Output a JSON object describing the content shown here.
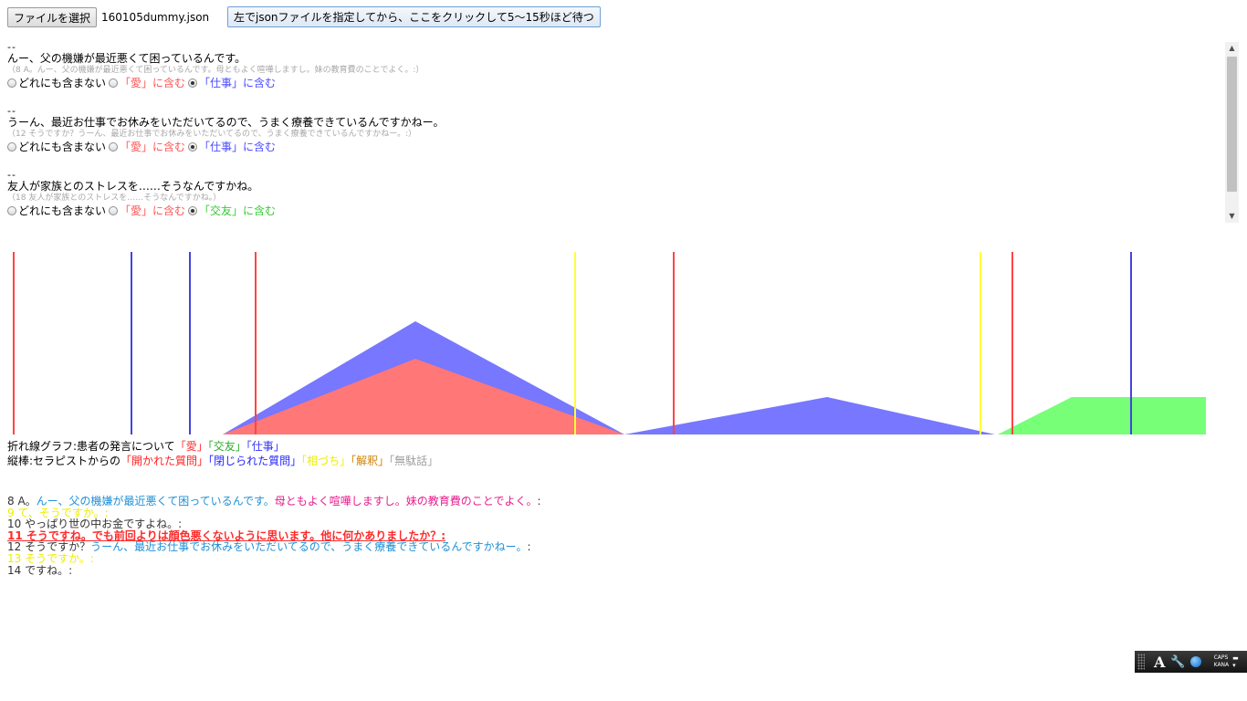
{
  "toolbar": {
    "file_button": "ファイルを選択",
    "file_name": "160105dummy.json",
    "analyze_button": "左でjsonファイルを指定してから、ここをクリックして5〜15秒ほど待つ"
  },
  "entries": [
    {
      "separator": "--",
      "utterance": "んー、父の機嫌が最近悪くて困っているんです。",
      "context": "（8 A。んー、父の機嫌が最近悪くて困っているんです。母ともよく喧嘩しますし。妹の教育費のことでよく。:）",
      "options": [
        {
          "label": "どれにも含まない",
          "checked": false,
          "color": "#000000"
        },
        {
          "label": "「愛」に含む",
          "checked": false,
          "color": "#ff5555"
        },
        {
          "label": "「仕事」に含む",
          "checked": true,
          "color": "#4a4aff"
        }
      ]
    },
    {
      "separator": "--",
      "utterance": "うーん、最近お仕事でお休みをいただいてるので、うまく療養できているんですかねー。",
      "context": "（12 そうですか？うーん、最近お仕事でお休みをいただいてるので、うまく療養できているんですかねー。:）",
      "options": [
        {
          "label": "どれにも含まない",
          "checked": false,
          "color": "#000000"
        },
        {
          "label": "「愛」に含む",
          "checked": false,
          "color": "#ff5555"
        },
        {
          "label": "「仕事」に含む",
          "checked": true,
          "color": "#4a4aff"
        }
      ]
    },
    {
      "separator": "--",
      "utterance": "友人が家族とのストレスを……そうなんですかね。",
      "context": "（18 友人が家族とのストレスを……そうなんですかね。）",
      "options": [
        {
          "label": "どれにも含まない",
          "checked": false,
          "color": "#000000"
        },
        {
          "label": "「愛」に含む",
          "checked": false,
          "color": "#ff5555"
        },
        {
          "label": "「交友」に含む",
          "checked": true,
          "color": "#33cc33"
        }
      ]
    }
  ],
  "legend": {
    "line1_prefix": "折れ線グラフ:患者の発言について",
    "love": "「愛」",
    "friend": "「交友」",
    "work": "「仕事」",
    "line2_prefix": "縦棒:セラピストからの",
    "open_q": "「開かれた質問」",
    "closed_q": "「閉じられた質問」",
    "aizuchi": "「相づち」",
    "interp": "「解釈」",
    "nochat": "「無駄話」"
  },
  "chart_data": {
    "type": "area",
    "xlim": [
      0,
      1330
    ],
    "ylim": [
      0,
      200
    ],
    "series": [
      {
        "color": "#7777ff",
        "points": [
          [
            236,
            0
          ],
          [
            447,
            124
          ],
          [
            676,
            0
          ],
          [
            898,
            41
          ],
          [
            1082,
            0
          ]
        ]
      },
      {
        "color": "#ff7777",
        "points": [
          [
            236,
            0
          ],
          [
            447,
            83
          ],
          [
            676,
            0
          ]
        ]
      },
      {
        "color": "#77ff77",
        "points": [
          [
            1085,
            0
          ],
          [
            1166,
            41
          ],
          [
            1313,
            41
          ],
          [
            1313,
            0
          ]
        ]
      }
    ],
    "vlines": [
      {
        "x": 7,
        "kind": "open",
        "color": "#ff4444"
      },
      {
        "x": 136,
        "kind": "closed",
        "color": "#4444dd"
      },
      {
        "x": 200,
        "kind": "closed",
        "color": "#4444dd"
      },
      {
        "x": 272,
        "kind": "open",
        "color": "#ff4444"
      },
      {
        "x": 622,
        "kind": "aizuchi",
        "color": "#ffff33"
      },
      {
        "x": 730,
        "kind": "open",
        "color": "#ff4444"
      },
      {
        "x": 1066,
        "kind": "aizuchi",
        "color": "#ffff33"
      },
      {
        "x": 1101,
        "kind": "open",
        "color": "#ff4444"
      },
      {
        "x": 1231,
        "kind": "closed",
        "color": "#4444dd"
      }
    ]
  },
  "transcript": [
    [
      {
        "text": "8 A。",
        "cls": "t-gray"
      },
      {
        "text": "んー、父の機嫌が最近悪くて困っているんです。",
        "cls": "t-blue"
      },
      {
        "text": "母ともよく喧嘩しますし。妹の教育費のことでよく。",
        "cls": "t-pink"
      },
      {
        "text": ":",
        "cls": "t-gray"
      }
    ],
    [
      {
        "text": "9 て、そうですか。:",
        "cls": "t-yellow"
      }
    ],
    [
      {
        "text": "10 やっぱり世の中お金ですよね。:",
        "cls": "t-gray"
      }
    ],
    [
      {
        "text": "11 そうですね。でも前回よりは顔色悪くないように思います。他に何かありましたか？:",
        "cls": "t-red"
      }
    ],
    [
      {
        "text": "12 そうですか？",
        "cls": "t-gray"
      },
      {
        "text": "うーん、最近お仕事でお休みをいただいてるので、うまく療養できているんですかねー。",
        "cls": "t-blue"
      },
      {
        "text": ":",
        "cls": "t-gray"
      }
    ],
    [
      {
        "text": "13 そうですか。:",
        "cls": "t-yellow"
      }
    ],
    [
      {
        "text": "14 ですね。:",
        "cls": "t-gray"
      }
    ]
  ],
  "imebar": {
    "a_label": "A",
    "caps": "CAPS",
    "kana": "KANA"
  }
}
